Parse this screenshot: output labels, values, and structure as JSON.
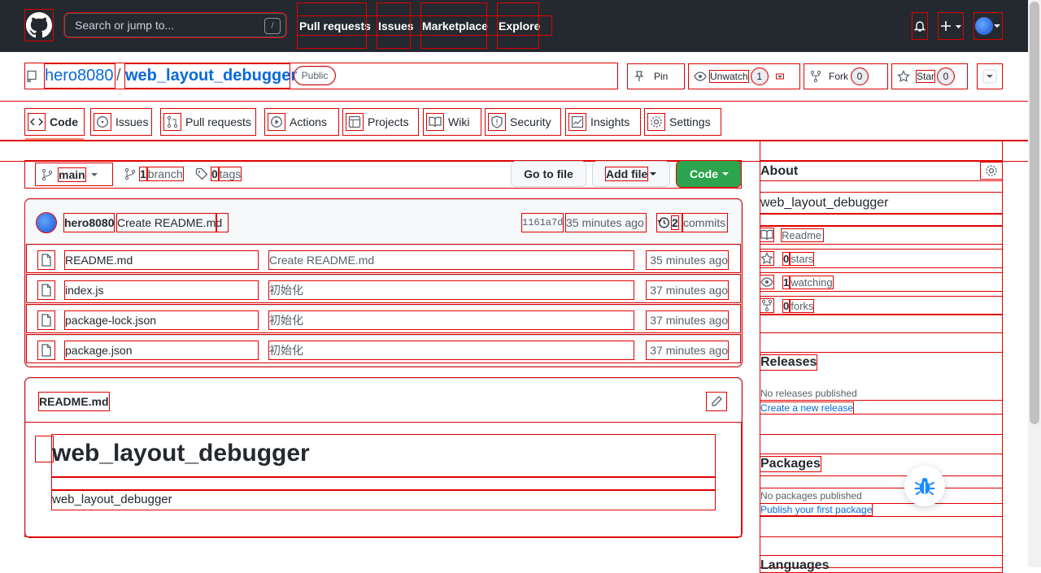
{
  "header": {
    "search_placeholder": "Search or jump to...",
    "search_shortcut": "/",
    "nav": [
      "Pull requests",
      "Issues",
      "Marketplace",
      "Explore"
    ]
  },
  "repo": {
    "owner": "hero8080",
    "separator": "/",
    "name": "web_layout_debugger",
    "visibility": "Public",
    "actions": {
      "pin": "Pin",
      "unwatch": "Unwatch",
      "unwatch_count": "1",
      "fork": "Fork",
      "fork_count": "0",
      "star": "Star",
      "star_count": "0"
    }
  },
  "tabs": [
    "Code",
    "Issues",
    "Pull requests",
    "Actions",
    "Projects",
    "Wiki",
    "Security",
    "Insights",
    "Settings"
  ],
  "branch_bar": {
    "branch": "main",
    "branch_count": "1",
    "branch_label": "branch",
    "tag_count": "0",
    "tag_label": "tags",
    "go_to_file": "Go to file",
    "add_file": "Add file",
    "code": "Code"
  },
  "commit": {
    "author": "hero8080",
    "message": "Create README.md",
    "sha": "1161a7d",
    "time": "35 minutes ago",
    "commit_count": "2",
    "commits_label": "commits"
  },
  "files": [
    {
      "name": "README.md",
      "message": "Create README.md",
      "time": "35 minutes ago"
    },
    {
      "name": "index.js",
      "message": "初始化",
      "time": "37 minutes ago"
    },
    {
      "name": "package-lock.json",
      "message": "初始化",
      "time": "37 minutes ago"
    },
    {
      "name": "package.json",
      "message": "初始化",
      "time": "37 minutes ago"
    }
  ],
  "readme": {
    "filename": "README.md",
    "heading": "web_layout_debugger",
    "body": "web_layout_debugger"
  },
  "sidebar": {
    "about_title": "About",
    "description": "web_layout_debugger",
    "readme": "Readme",
    "stars_count": "0",
    "stars_label": "stars",
    "watching_count": "1",
    "watching_label": "watching",
    "forks_count": "0",
    "forks_label": "forks",
    "releases_title": "Releases",
    "releases_empty": "No releases published",
    "releases_link": "Create a new release",
    "packages_title": "Packages",
    "packages_empty": "No packages published",
    "packages_link": "Publish your first package",
    "languages_title": "Languages"
  },
  "colors": {
    "header_bg": "#24292f",
    "code_button": "#2da44e",
    "link": "#0969da",
    "debug_outline": "#e00000"
  }
}
